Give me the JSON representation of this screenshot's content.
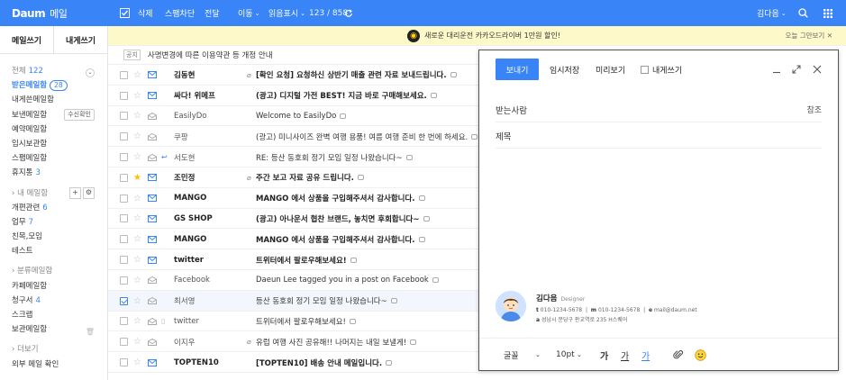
{
  "header": {
    "logo": "Daum",
    "service": "메일",
    "select_all_icon": "checkbox-icon",
    "delete": "삭제",
    "block_spam": "스팸차단",
    "forward": "전달",
    "move": "이동",
    "read_display": "읽음표시",
    "count": "123 / 858",
    "user": "김다음",
    "accent_color": "#3984f6"
  },
  "sidebar": {
    "write_mail": "메일쓰기",
    "write_self": "내게쓰기",
    "all_label": "전체",
    "all_count": "122",
    "inbox": "받은메일함",
    "inbox_count": "28",
    "self_box": "내게쓴메일함",
    "sent": "보낸메일함",
    "read_receipt": "수신확인",
    "reserved": "예약메일함",
    "drafts": "임시보관함",
    "spam": "스팸메일함",
    "trash": "휴지통",
    "trash_count": "3",
    "my_folders": "내 메일함",
    "dev": "개편관련",
    "dev_count": "6",
    "work": "업무",
    "work_count": "7",
    "friends": "친목,모임",
    "test": "테스트",
    "categories": "분류메일함",
    "cafe": "카페메일함",
    "billing": "청구서",
    "billing_count": "4",
    "scrap": "스크랩",
    "archive": "보관메일함",
    "more": "더보기",
    "external": "외부 메일 확인"
  },
  "banner": {
    "text": "새로운 대리운전 카카오드라이버 1만원 할인!",
    "close": "오늘 그만보기 ✕"
  },
  "notice": {
    "tag": "공지",
    "text": "사명변경에 따른 이용약관 등 개정 안내"
  },
  "mails": [
    {
      "sender": "김동현",
      "subject": "[확인 요청] 요청하신 상반기 매출 관련 자료 보내드립니다.",
      "clip": "⌀",
      "unread": true
    },
    {
      "sender": "싸다! 위메프",
      "subject": "(광고) 디지털 가전 BEST! 지금 바로 구매해보세요.",
      "clip": "",
      "unread": true
    },
    {
      "sender": "EasilyDo",
      "subject": "Welcome to EasilyDo",
      "clip": "",
      "unread": false
    },
    {
      "sender": "쿠팡",
      "subject": "(광고) 미니사이즈 완벽 여행 용품! 여름 여행 준비 한 번에 하세요.",
      "clip": "",
      "unread": false
    },
    {
      "sender": "서도현",
      "subject": "RE: 등산 동호회 정기 모임 일정 나왔습니다~",
      "clip": "",
      "unread": false
    },
    {
      "sender": "조민정",
      "subject": "주간 보고 자료 공유 드립니다.",
      "clip": "⌀",
      "unread": true
    },
    {
      "sender": "MANGO",
      "subject": "MANGO 에서 상품을 구입해주셔서 감사합니다.",
      "clip": "",
      "unread": true
    },
    {
      "sender": "GS SHOP",
      "subject": "(광고) 아나운서 협찬 브랜드, 놓치면 후회합니다~",
      "clip": "",
      "unread": true
    },
    {
      "sender": "MANGO",
      "subject": "MANGO 에서 상품을 구입해주셔서 감사합니다.",
      "clip": "",
      "unread": true
    },
    {
      "sender": "twitter",
      "subject": "트위터에서 팔로우해보세요!",
      "clip": "",
      "unread": true
    },
    {
      "sender": "Facebook",
      "subject": "Daeun Lee tagged you in a post on Facebook",
      "clip": "",
      "unread": false
    },
    {
      "sender": "최서영",
      "subject": "등산 동호회 정기 모임 일정 나왔습니다~",
      "clip": "",
      "unread": false
    },
    {
      "sender": "twitter",
      "subject": "트위터에서 팔로우해보세요!",
      "clip": "",
      "unread": false
    },
    {
      "sender": "이지우",
      "subject": "유럽 여행 사진 공유해!! 나머지는 내일 보낼게!",
      "clip": "⌀",
      "unread": false
    },
    {
      "sender": "TOPTEN10",
      "subject": "[TOPTEN10] 배송 안내 메일입니다.",
      "clip": "",
      "unread": true
    }
  ],
  "compose": {
    "send": "보내기",
    "save_draft": "임시저장",
    "preview": "미리보기",
    "to_self": "내게쓰기",
    "to_label": "받는사람",
    "cc_label": "참조",
    "subject_label": "제목",
    "sig_name": "김다음",
    "sig_role": "Designer",
    "sig_t_label": "t",
    "sig_t": "010-1234-5678",
    "sig_m_label": "m",
    "sig_m": "010-1234-5678",
    "sig_e_label": "e",
    "sig_e": "mail@daum.net",
    "sig_a_label": "a",
    "sig_a": "성남시 분당구 판교역로 235 H스퀘어",
    "font": "굴꼴",
    "size": "10pt",
    "bold": "가",
    "italic": "가",
    "underline": "가"
  }
}
